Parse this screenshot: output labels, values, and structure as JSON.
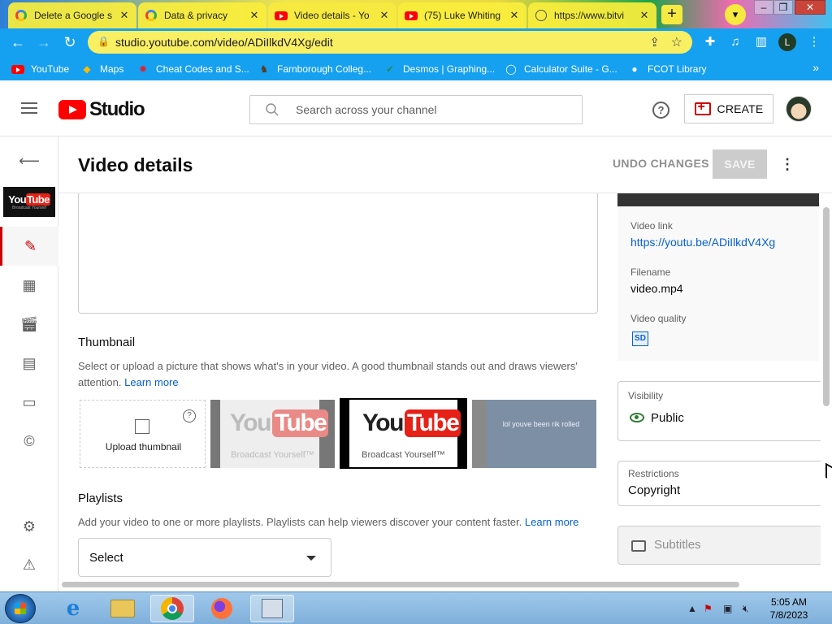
{
  "browser": {
    "tabs": [
      {
        "title": "Delete a Google s",
        "icon": "google-icon"
      },
      {
        "title": "Data & privacy",
        "icon": "google-icon"
      },
      {
        "title": "Video details - Yo",
        "icon": "youtube-icon",
        "active": true
      },
      {
        "title": "(75) Luke Whiting",
        "icon": "youtube-icon"
      },
      {
        "title": "https://www.bitvi",
        "icon": "globe-icon"
      }
    ],
    "new_tab": "+",
    "url": "studio.youtube.com/video/ADiIlkdV4Xg/edit",
    "profile_initial": "L",
    "bookmarks": [
      {
        "label": "YouTube",
        "icon": "youtube-icon"
      },
      {
        "label": "Maps",
        "icon": "maps-icon"
      },
      {
        "label": "Cheat Codes and S...",
        "icon": "gear-icon"
      },
      {
        "label": "Farnborough Colleg...",
        "icon": "college-icon"
      },
      {
        "label": "Desmos | Graphing...",
        "icon": "desmos-icon"
      },
      {
        "label": "Calculator Suite - G...",
        "icon": "geogebra-icon"
      },
      {
        "label": "FCOT Library",
        "icon": "library-icon"
      }
    ]
  },
  "studio": {
    "logo_text": "Studio",
    "search_placeholder": "Search across your channel",
    "help": "?",
    "create_label": "CREATE",
    "page_title": "Video details",
    "undo_label": "UNDO CHANGES",
    "save_label": "SAVE",
    "kebab": "⋮",
    "thumbnail": {
      "heading": "Thumbnail",
      "description": "Select or upload a picture that shows what's in your video. A good thumbnail stands out and draws viewers' attention.",
      "learn_more": "Learn more",
      "upload_label": "Upload thumbnail",
      "options": [
        {
          "you": "You",
          "tube": "Tube",
          "tagline": "Broadcast Yourself™",
          "faded": true
        },
        {
          "you": "You",
          "tube": "Tube",
          "tagline": "Broadcast Yourself™",
          "selected": true
        },
        {
          "text": "lol youve been rik rolled"
        }
      ]
    },
    "playlists": {
      "heading": "Playlists",
      "description": "Add your video to one or more playlists. Playlists can help viewers discover your content faster.",
      "learn_more": "Learn more",
      "select_value": "Select"
    },
    "video_info": {
      "link_label": "Video link",
      "link": "https://youtu.be/ADiIlkdV4Xg",
      "filename_label": "Filename",
      "filename": "video.mp4",
      "quality_label": "Video quality",
      "quality_badge": "SD"
    },
    "visibility": {
      "label": "Visibility",
      "value": "Public"
    },
    "restrictions": {
      "label": "Restrictions",
      "value": "Copyright"
    },
    "subtitles_label": "Subtitles",
    "sidebar_thumb": {
      "you": "You",
      "tube": "Tube",
      "tagline": "Broadcast Yourself"
    }
  },
  "taskbar": {
    "time": "5:05 AM",
    "date": "7/8/2023"
  },
  "colors": {
    "accent_red": "#cc0000",
    "link_blue": "#065fd4",
    "chrome_toolbar": "#16a0f0"
  }
}
